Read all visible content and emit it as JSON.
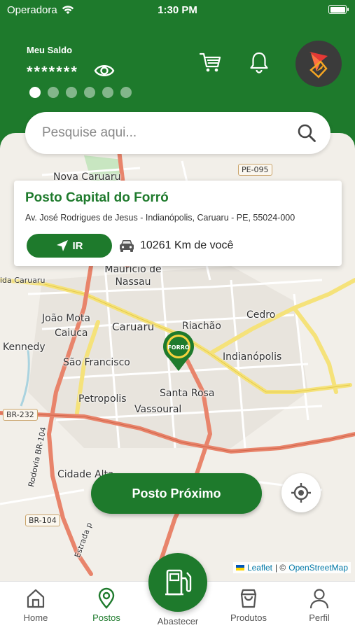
{
  "status_bar": {
    "carrier": "Operadora",
    "time": "1:30 PM"
  },
  "header": {
    "balance_label": "Meu Saldo",
    "balance_value": "*******",
    "carousel": {
      "count": 6,
      "active_index": 0
    }
  },
  "search": {
    "placeholder": "Pesquise aqui..."
  },
  "station_card": {
    "name": "Posto Capital do Forró",
    "address": "Av. José Rodrigues de Jesus - Indianópolis, Caruaru - PE, 55024-000",
    "go_label": "IR",
    "distance": "10261 Km de você"
  },
  "map": {
    "labels": [
      "Nova Caruaru",
      "Maurício de Nassau",
      "João Mota",
      "Caiuca",
      "Kennedy",
      "Caruaru",
      "Riachão",
      "Cedro",
      "Indianópolis",
      "São Francisco",
      "Petropolis",
      "Santa Rosa",
      "Vassoural",
      "Cidade Alta",
      "ida Caruaru"
    ],
    "roads": [
      "PE-095",
      "BR-232",
      "BR-104",
      "Rodovia BR-104",
      "Estrada p"
    ],
    "pin_label": "FORRÓ"
  },
  "actions": {
    "nearest_label": "Posto Próximo"
  },
  "attribution": {
    "leaflet": "Leaflet",
    "separator": "| ©",
    "osm": "OpenStreetMap"
  },
  "nav": {
    "items": [
      {
        "label": "Home",
        "icon": "home-icon"
      },
      {
        "label": "Postos",
        "icon": "map-pin-icon"
      },
      {
        "label": "Abastecer",
        "icon": "fuel-pump-icon"
      },
      {
        "label": "Produtos",
        "icon": "shopping-bag-icon"
      },
      {
        "label": "Perfil",
        "icon": "user-icon"
      }
    ],
    "active": "Postos"
  },
  "colors": {
    "brand_green": "#1e7a2c",
    "map_bg": "#f2efe9",
    "road_orange": "#e8846b",
    "road_yellow": "#f5e27a"
  }
}
